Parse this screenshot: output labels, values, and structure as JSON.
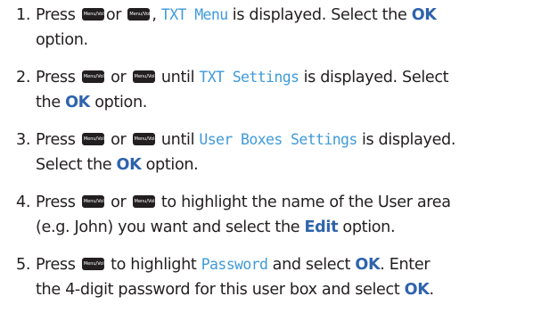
{
  "keys": {
    "vol_up": "Menu/Vol+",
    "vol_down": "Menu/Vol-"
  },
  "steps": [
    {
      "num": "1.",
      "l1_a": "Press",
      "l1_b": "or",
      "l1_c": ",",
      "l1_lcd": "TXT Menu",
      "l1_d": "is displayed. Select the",
      "l1_bold": "OK",
      "l2_a": "option."
    },
    {
      "num": "2.",
      "l1_a": "Press",
      "l1_b": "or",
      "l1_c": "until",
      "l1_lcd": "TXT Settings",
      "l1_d": "is displayed. Select",
      "l2_a": "the",
      "l2_bold": "OK",
      "l2_b": "option."
    },
    {
      "num": "3.",
      "l1_a": "Press",
      "l1_b": "or",
      "l1_c": "until",
      "l1_lcd": "User Boxes Settings",
      "l1_d": "is displayed.",
      "l2_a": "Select the",
      "l2_bold": "OK",
      "l2_b": "option."
    },
    {
      "num": "4.",
      "l1_a": "Press",
      "l1_b": "or",
      "l1_c": "to highlight the name of the User area",
      "l2_a": "(e.g. John) you want and select the",
      "l2_bold": "Edit",
      "l2_b": "option."
    },
    {
      "num": "5.",
      "l1_a": "Press",
      "l1_b": "to highlight",
      "l1_lcd": "Password",
      "l1_c": "and select",
      "l1_bold": "OK",
      "l1_d": ". Enter",
      "l2_a": "the 4-digit password for this user box and select",
      "l2_bold": "OK",
      "l2_b": "."
    }
  ]
}
